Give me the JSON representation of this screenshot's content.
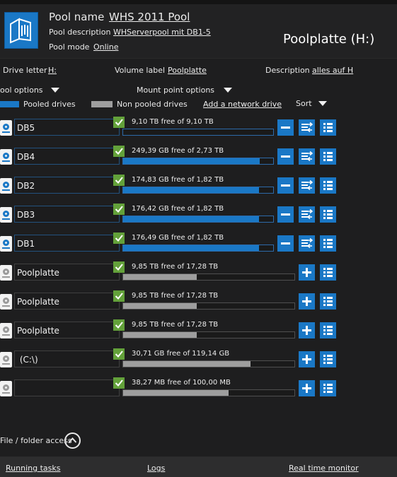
{
  "header": {
    "pool_name_label": "Pool name",
    "pool_name": "WHS 2011 Pool",
    "pool_description_label": "Pool description",
    "pool_description": "WHServerpool mit DB1-5",
    "pool_mode_label": "Pool mode",
    "pool_mode": "Online",
    "drive_title": "Poolplatte (H:)"
  },
  "info": {
    "drive_letter_label": "Drive letter",
    "drive_letter": "H:",
    "volume_label_label": "Volume label",
    "volume_label": "Poolplatte",
    "description_label": "Description",
    "description": "alles auf H"
  },
  "options": {
    "pool_options": "ool options",
    "mount_point_options": "Mount point options"
  },
  "legend": {
    "pooled": "Pooled drives",
    "non_pooled": "Non pooled drives",
    "add_network": "Add a network drive",
    "sort": "Sort"
  },
  "drives": [
    {
      "name": "DB5",
      "free": "9,10 TB free of 9,10 TB",
      "pooled": true,
      "used_fraction": 0.0
    },
    {
      "name": "DB4",
      "free": "249,39 GB free of 2,73 TB",
      "pooled": true,
      "used_fraction": 0.91
    },
    {
      "name": "DB2",
      "free": "174,83 GB free of 1,82 TB",
      "pooled": true,
      "used_fraction": 0.906
    },
    {
      "name": "DB3",
      "free": "176,42 GB free of 1,82 TB",
      "pooled": true,
      "used_fraction": 0.905
    },
    {
      "name": "DB1",
      "free": "176,49 GB free of 1,82 TB",
      "pooled": true,
      "used_fraction": 0.905
    },
    {
      "name": "Poolplatte",
      "free": "9,85 TB free of 17,28 TB",
      "pooled": false,
      "used_fraction": 0.43
    },
    {
      "name": "Poolplatte",
      "free": "9,85 TB free of 17,28 TB",
      "pooled": false,
      "used_fraction": 0.43
    },
    {
      "name": "Poolplatte",
      "free": "9,85 TB free of 17,28 TB",
      "pooled": false,
      "used_fraction": 0.43
    },
    {
      "name": " (C:\\)",
      "free": "30,71 GB free of 119,14 GB",
      "pooled": false,
      "used_fraction": 0.742
    },
    {
      "name": "",
      "free": "38,27 MB free of 100,00 MB",
      "pooled": false,
      "used_fraction": 0.617
    }
  ],
  "bottom": {
    "file_folder_access": "File / folder access"
  },
  "footer": {
    "running_tasks": "Running tasks",
    "logs": "Logs",
    "real_time_monitor": "Real time monitor"
  },
  "colors": {
    "accent": "#1a78c6",
    "check": "#63a13a",
    "non_pooled_bar": "#9e9e9e",
    "background": "#1e1e1f"
  }
}
